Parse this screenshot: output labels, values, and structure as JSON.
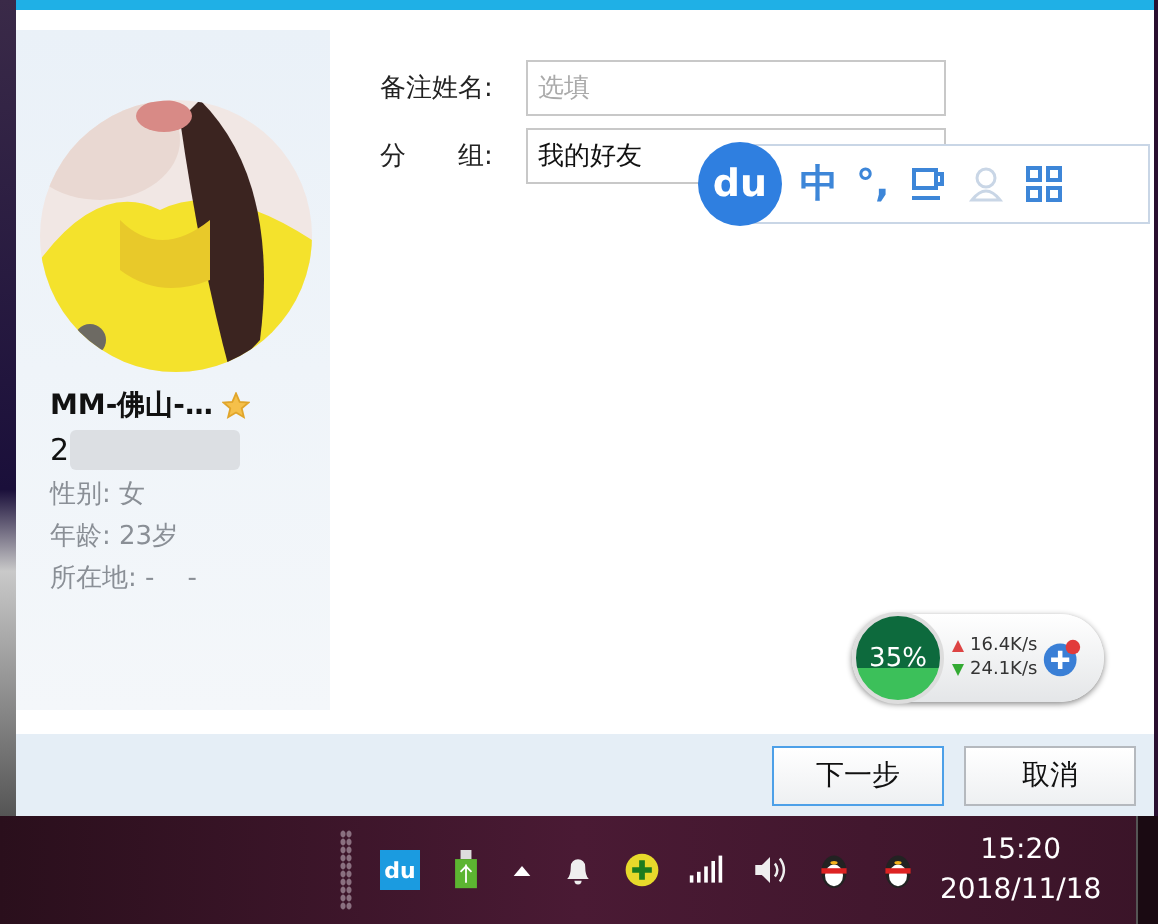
{
  "profile": {
    "name": "MM-佛山-…",
    "starred": true,
    "id": "2",
    "details": [
      "性别: 女",
      "年龄: 23岁",
      "所在地: -    -"
    ]
  },
  "form": [
    {
      "label": "备注姓名:",
      "kind": "text",
      "placeholder": "选填"
    },
    {
      "label": "分　　组:",
      "kind": "select",
      "value": "我的好友"
    }
  ],
  "ime_toolbar": {
    "logo": "du",
    "items": [
      "中",
      "°,"
    ]
  },
  "net_widget": {
    "percent": "35%",
    "upload": "16.4K/s",
    "download": "24.1K/s"
  },
  "buttons": [
    {
      "label": "下一步",
      "focused": true
    },
    {
      "label": "取消",
      "focused": false
    }
  ],
  "taskbar": {
    "tray_logo": "du",
    "time": "15:20",
    "date": "2018/11/18"
  }
}
